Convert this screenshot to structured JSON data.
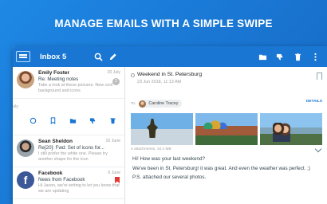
{
  "banner": {
    "title": "MANAGE EMAILS WITH A SIMPLE SWIPE"
  },
  "appbar": {
    "title": "Inbox 5"
  },
  "mail_list": [
    {
      "from": "Emily Foster",
      "subject": "Re: Meeting notes",
      "preview": "Take a look at these pictures. New cool background and icons",
      "date": "20 July",
      "count": "2"
    },
    {
      "swipe_label": "uly"
    },
    {
      "from": "Sean Sheldon",
      "subject": "Re[20]: Fwd: Set of icons for...",
      "preview": "I still prefer the white one. Please try another shape for the icon",
      "date": "10 June"
    },
    {
      "from": "Facebook",
      "subject": "News from Facebook",
      "preview": "Hi Jason, we're writing to let you know that we are updating",
      "date": "6 June",
      "avatar_letter": "f"
    }
  ],
  "detail": {
    "subject": "Weekend in St. Petersburg",
    "date": "23 Jun 2018, 11:13 AM",
    "to_label": "To:",
    "recipient": "Caroline Tracey",
    "details_link": "DETAILS",
    "attachments": "4 attachments, 10.2 MB",
    "body": [
      "Hi! How was your last weekend?",
      "We've been in St. Petersburg! it was great. And even the weather was perfect. ;)",
      "P.S. attached our several photos."
    ]
  },
  "colors": {
    "brand": "#1976d2",
    "banner_bg": "#1e88e5",
    "flag": "#e53935"
  }
}
